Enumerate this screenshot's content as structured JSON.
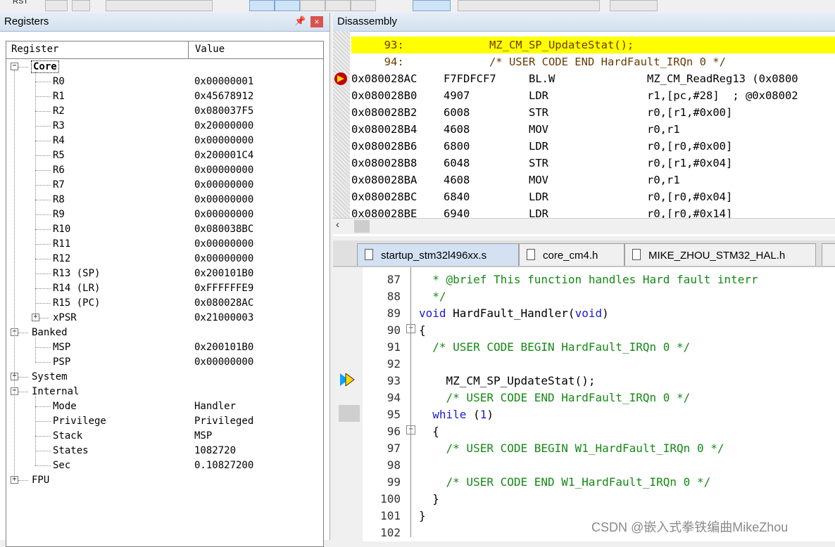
{
  "toolbar": {
    "rst_label": "RST"
  },
  "registers": {
    "title": "Registers",
    "col_register": "Register",
    "col_value": "Value",
    "rows": [
      {
        "name": "Core",
        "value": "",
        "level": 0,
        "expander": "−"
      },
      {
        "name": "R0",
        "value": "0x00000001",
        "level": 1
      },
      {
        "name": "R1",
        "value": "0x45678912",
        "level": 1
      },
      {
        "name": "R2",
        "value": "0x080037F5",
        "level": 1
      },
      {
        "name": "R3",
        "value": "0x20000000",
        "level": 1
      },
      {
        "name": "R4",
        "value": "0x00000000",
        "level": 1
      },
      {
        "name": "R5",
        "value": "0x200001C4",
        "level": 1
      },
      {
        "name": "R6",
        "value": "0x00000000",
        "level": 1
      },
      {
        "name": "R7",
        "value": "0x00000000",
        "level": 1
      },
      {
        "name": "R8",
        "value": "0x00000000",
        "level": 1
      },
      {
        "name": "R9",
        "value": "0x00000000",
        "level": 1
      },
      {
        "name": "R10",
        "value": "0x080038BC",
        "level": 1
      },
      {
        "name": "R11",
        "value": "0x00000000",
        "level": 1
      },
      {
        "name": "R12",
        "value": "0x00000000",
        "level": 1
      },
      {
        "name": "R13 (SP)",
        "value": "0x200101B0",
        "level": 1
      },
      {
        "name": "R14 (LR)",
        "value": "0xFFFFFFE9",
        "level": 1
      },
      {
        "name": "R15 (PC)",
        "value": "0x080028AC",
        "level": 1
      },
      {
        "name": "xPSR",
        "value": "0x21000003",
        "level": 1,
        "expander": "+"
      },
      {
        "name": "Banked",
        "value": "",
        "level": 0,
        "expander": "−"
      },
      {
        "name": "MSP",
        "value": "0x200101B0",
        "level": 1
      },
      {
        "name": "PSP",
        "value": "0x00000000",
        "level": 1
      },
      {
        "name": "System",
        "value": "",
        "level": 0,
        "expander": "+"
      },
      {
        "name": "Internal",
        "value": "",
        "level": 0,
        "expander": "−"
      },
      {
        "name": "Mode",
        "value": "Handler",
        "level": 1
      },
      {
        "name": "Privilege",
        "value": "Privileged",
        "level": 1
      },
      {
        "name": "Stack",
        "value": "MSP",
        "level": 1
      },
      {
        "name": "States",
        "value": "1082720",
        "level": 1
      },
      {
        "name": "Sec",
        "value": "0.10827200",
        "level": 1
      },
      {
        "name": "FPU",
        "value": "",
        "level": 0,
        "expander": "+"
      }
    ]
  },
  "disassembly": {
    "title": "Disassembly",
    "lines": [
      {
        "addr": "",
        "op": "",
        "mnem": "",
        "args": "",
        "src": "     93:             MZ_CM_SP_UpdateStat();",
        "kind": "src-hl"
      },
      {
        "addr": "",
        "op": "",
        "mnem": "",
        "args": "",
        "src": "     94:             /* USER CODE END HardFault_IRQn 0 */",
        "kind": "src"
      },
      {
        "addr": "0x080028AC",
        "op": "F7FDFCF7",
        "mnem": "BL.W",
        "args": "MZ_CM_ReadReg13 (0x0800",
        "kind": "asm-cur"
      },
      {
        "addr": "0x080028B0",
        "op": "4907",
        "mnem": "LDR",
        "args": "r1,[pc,#28]  ; @0x08002",
        "kind": "asm"
      },
      {
        "addr": "0x080028B2",
        "op": "6008",
        "mnem": "STR",
        "args": "r0,[r1,#0x00]",
        "kind": "asm"
      },
      {
        "addr": "0x080028B4",
        "op": "4608",
        "mnem": "MOV",
        "args": "r0,r1",
        "kind": "asm"
      },
      {
        "addr": "0x080028B6",
        "op": "6800",
        "mnem": "LDR",
        "args": "r0,[r0,#0x00]",
        "kind": "asm"
      },
      {
        "addr": "0x080028B8",
        "op": "6048",
        "mnem": "STR",
        "args": "r0,[r1,#0x04]",
        "kind": "asm"
      },
      {
        "addr": "0x080028BA",
        "op": "4608",
        "mnem": "MOV",
        "args": "r0,r1",
        "kind": "asm"
      },
      {
        "addr": "0x080028BC",
        "op": "6840",
        "mnem": "LDR",
        "args": "r0,[r0,#0x04]",
        "kind": "asm"
      },
      {
        "addr": "0x080028BE",
        "op": "6940",
        "mnem": "LDR",
        "args": "r0,[r0,#0x14]",
        "kind": "asm"
      }
    ]
  },
  "editor": {
    "tabs": [
      {
        "label": "startup_stm32l496xx.s",
        "active": true
      },
      {
        "label": "core_cm4.h",
        "active": false
      },
      {
        "label": "MIKE_ZHOU_STM32_HAL.h",
        "active": false
      }
    ],
    "lines": [
      {
        "num": "87",
        "code": "  * @brief This function handles Hard fault interr",
        "cls": "c-com"
      },
      {
        "num": "88",
        "code": "  */",
        "cls": "c-com"
      },
      {
        "num": "89",
        "code": "void HardFault_Handler(void)",
        "cls": "mixed89"
      },
      {
        "num": "90",
        "code": "{",
        "cls": "c-txt"
      },
      {
        "num": "91",
        "code": "  /* USER CODE BEGIN HardFault_IRQn 0 */",
        "cls": "c-com"
      },
      {
        "num": "92",
        "code": "",
        "cls": "c-txt"
      },
      {
        "num": "93",
        "code": "    MZ_CM_SP_UpdateStat();",
        "cls": "c-txt"
      },
      {
        "num": "94",
        "code": "    /* USER CODE END HardFault_IRQn 0 */",
        "cls": "c-com"
      },
      {
        "num": "95",
        "code": "  while (1)",
        "cls": "mixed95"
      },
      {
        "num": "96",
        "code": "  {",
        "cls": "c-txt"
      },
      {
        "num": "97",
        "code": "    /* USER CODE BEGIN W1_HardFault_IRQn 0 */",
        "cls": "c-com"
      },
      {
        "num": "98",
        "code": "",
        "cls": "c-txt"
      },
      {
        "num": "99",
        "code": "    /* USER CODE END W1_HardFault_IRQn 0 */",
        "cls": "c-com"
      },
      {
        "num": "100",
        "code": "  }",
        "cls": "c-txt"
      },
      {
        "num": "101",
        "code": "}",
        "cls": "c-txt"
      },
      {
        "num": "102",
        "code": "",
        "cls": "c-txt"
      }
    ]
  },
  "watermark": "CSDN @嵌入式拳铁编曲MikeZhou"
}
